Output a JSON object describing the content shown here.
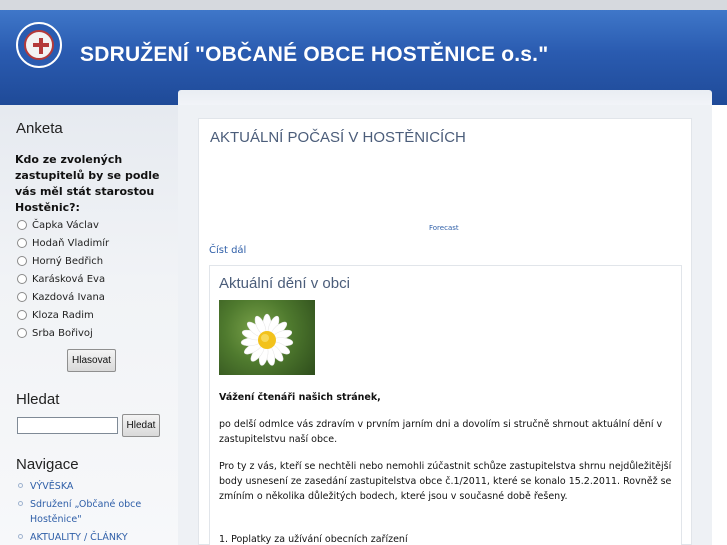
{
  "header": {
    "site_title": "SDRUŽENÍ \"OBČANÉ OBCE HOSTĚNICE o.s.\""
  },
  "sidebar": {
    "poll": {
      "heading": "Anketa",
      "question": "Kdo ze zvolených zastupitelů by se podle vás měl stát starostou Hostěnic?:",
      "options": [
        "Čapka Václav",
        "Hodaň Vladimír",
        "Horný Bedřich",
        "Karásková Eva",
        "Kazdová Ivana",
        "Kloza Radim",
        "Srba Bořivoj"
      ],
      "vote_button": "Hlasovat"
    },
    "search": {
      "heading": "Hledat",
      "input_value": "",
      "button": "Hledat"
    },
    "navigation": {
      "heading": "Navigace",
      "items": [
        {
          "label": "VÝVĚSKA"
        },
        {
          "label": "Sdružení „Občané obce Hostěnice\""
        },
        {
          "label": "AKTUALITY / ČLÁNKY"
        }
      ]
    }
  },
  "main": {
    "article_title": "AKTUÁLNÍ POČASÍ V HOSTĚNICÍCH",
    "forecast_link": "Forecast",
    "read_more": "Číst dál",
    "inner": {
      "title": "Aktuální dění v obci",
      "greeting": "Vážení čtenáři našich stránek,",
      "paragraphs": [
        "po delší odmlce vás zdravím v prvním jarním dni a dovolím si stručně shrnout aktuální dění v zastupitelstvu naší obce.",
        "Pro ty z vás, kteří se nechtěli nebo nemohli zúčastnit schůze zastupitelstva shrnu nejdůležitější body usnesení ze zasedání zastupitelstva obce č.1/2011, které se konalo 15.2.2011. Rovněž se zmíním o několika důležitých bodech, které jsou v současné době řešeny.",
        "1. Poplatky za užívání obecních zařízení"
      ]
    }
  },
  "colors": {
    "header_blue": "#2a5bb0",
    "link_blue": "#2f5fa8",
    "heading_slate": "#4b5d7a"
  },
  "icons": {
    "logo": "association-seal-icon",
    "radio": "radio-icon",
    "bullet": "bullet-icon"
  }
}
